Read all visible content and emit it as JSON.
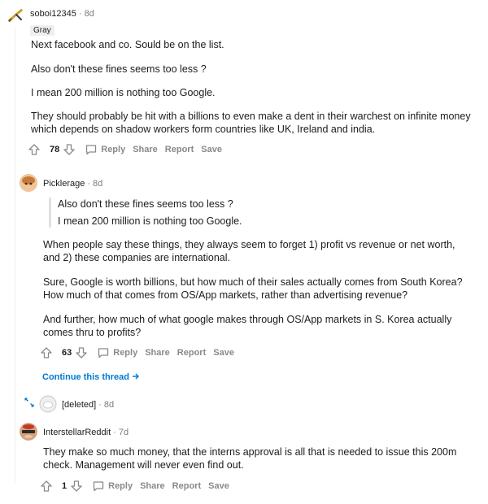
{
  "comment1": {
    "username": "soboi12345",
    "time": "8d",
    "flair": "Gray",
    "paragraphs": [
      "Next facebook and co. Sould be on the list.",
      "Also don't these fines seems too less ?",
      "I mean 200 million is nothing too Google.",
      "They should probably be hit with a billions to even make a dent in their warchest on infinite money which depends on shadow workers form countries like UK, Ireland and india."
    ],
    "score": "78",
    "reply": "Reply",
    "share": "Share",
    "report": "Report",
    "save": "Save"
  },
  "comment2": {
    "username": "Picklerage",
    "time": "8d",
    "quote": [
      "Also don't these fines seems too less ?",
      "I mean 200 million is nothing too Google."
    ],
    "paragraphs": [
      "When people say these things, they always seem to forget 1) profit vs revenue or net worth, and 2) these companies are international.",
      "Sure, Google is worth billions, but how much of their sales actually comes from South Korea? How much of that comes from OS/App markets, rather than advertising revenue?",
      "And further, how much of what google makes through OS/App markets in S. Korea actually comes thru to profits?"
    ],
    "score": "63",
    "reply": "Reply",
    "share": "Share",
    "report": "Report",
    "save": "Save",
    "continue": "Continue this thread"
  },
  "comment3": {
    "username": "[deleted]",
    "time": "8d"
  },
  "comment4": {
    "username": "InterstellarReddit",
    "time": "7d",
    "paragraphs": [
      "They make so much money, that the interns approval is all that is needed to issue this 200m check. Management will never even find out."
    ],
    "score": "1",
    "reply": "Reply",
    "share": "Share",
    "report": "Report",
    "save": "Save"
  },
  "colors": {
    "text": "#1c1c1c",
    "muted": "#7c7c7c",
    "link": "#0079d3",
    "flair_bg": "#edeff1"
  }
}
